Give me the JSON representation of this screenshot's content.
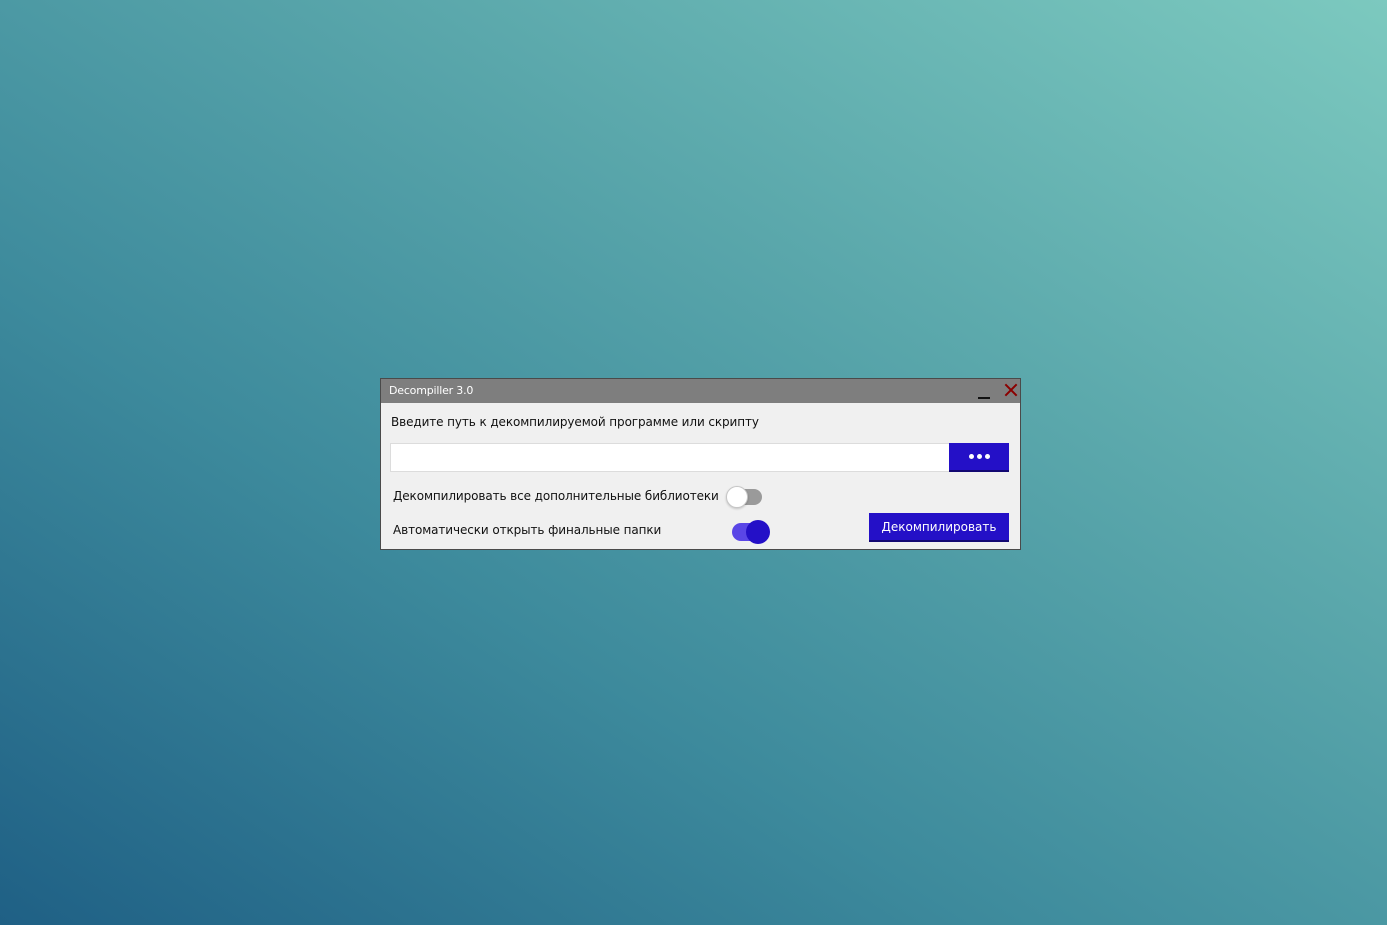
{
  "window": {
    "title": "Decompiller 3.0"
  },
  "main": {
    "path_label": "Введите путь к декомпилируемой программе или скрипту",
    "path_input": {
      "value": "",
      "placeholder": ""
    },
    "browse_button_icon": "ellipsis-icon",
    "option_decompile_libraries": {
      "label": "Декомпилировать все дополнительные библиотеки",
      "enabled": false
    },
    "option_open_folders": {
      "label": "Автоматически открыть финальные папки",
      "enabled": true
    },
    "decompile_button_label": "Декомпилировать"
  },
  "colors": {
    "accent": "#2410c7",
    "toggle_on_track": "#5a46e6",
    "titlebar": "#7e7e7e",
    "close": "#8b0000"
  }
}
